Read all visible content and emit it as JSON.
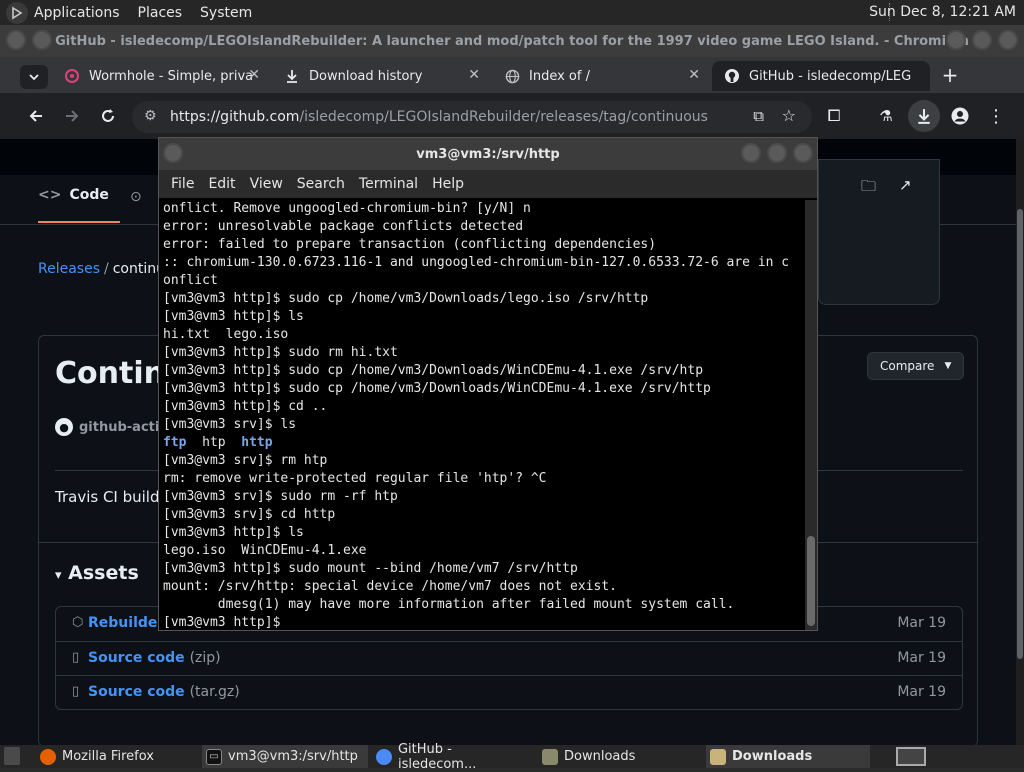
{
  "top_panel": {
    "menus": [
      "Applications",
      "Places",
      "System"
    ],
    "clock": "Sun Dec  8, 12:21 AM"
  },
  "chromium": {
    "window_title": "GitHub - isledecomp/LEGOIslandRebuilder: A launcher and mod/patch tool for the 1997 video game LEGO Island. - Chromium",
    "tabs": [
      {
        "title": "Wormhole - Simple, priva",
        "icon": "wormhole-icon"
      },
      {
        "title": "Download history",
        "icon": "download-icon"
      },
      {
        "title": "Index of /",
        "icon": "globe-icon"
      },
      {
        "title": "GitHub - isledecomp/LEG",
        "icon": "github-icon",
        "active": true
      }
    ],
    "url_host": "https://github.com",
    "url_path": "/isledecomp/LEGOIslandRebuilder/releases/tag/continuous"
  },
  "github": {
    "code_tab": "Code",
    "breadcrumb_link": "Releases",
    "breadcrumb_sep": "/",
    "breadcrumb_current": "continu",
    "release_title": "Contin",
    "compare_label": "Compare",
    "author": "github-actio",
    "body_text": "Travis CI build",
    "assets_heading": "Assets",
    "assets": [
      {
        "name": "Rebuilder.e",
        "format": "",
        "date": "Mar 19",
        "icon": "package-icon"
      },
      {
        "name": "Source code",
        "format": "(zip)",
        "date": "Mar 19",
        "icon": "file-zip-icon"
      },
      {
        "name": "Source code",
        "format": "(tar.gz)",
        "date": "Mar 19",
        "icon": "file-zip-icon"
      }
    ]
  },
  "terminal": {
    "title": "vm3@vm3:/srv/http",
    "menu": [
      "File",
      "Edit",
      "View",
      "Search",
      "Terminal",
      "Help"
    ],
    "lines": [
      "onflict. Remove ungoogled-chromium-bin? [y/N] n",
      "error: unresolvable package conflicts detected",
      "error: failed to prepare transaction (conflicting dependencies)",
      ":: chromium-130.0.6723.116-1 and ungoogled-chromium-bin-127.0.6533.72-6 are in c",
      "onflict",
      "[vm3@vm3 http]$ sudo cp /home/vm3/Downloads/lego.iso /srv/http",
      "[vm3@vm3 http]$ ls",
      "hi.txt  lego.iso",
      "[vm3@vm3 http]$ sudo rm hi.txt",
      "[vm3@vm3 http]$ sudo cp /home/vm3/Downloads/WinCDEmu-4.1.exe /srv/htp",
      "[vm3@vm3 http]$ sudo cp /home/vm3/Downloads/WinCDEmu-4.1.exe /srv/http",
      "[vm3@vm3 http]$ cd ..",
      "[vm3@vm3 srv]$ ls",
      "",
      "[vm3@vm3 srv]$ rm htp",
      "rm: remove write-protected regular file 'htp'? ^C",
      "[vm3@vm3 srv]$ sudo rm -rf htp",
      "[vm3@vm3 srv]$ cd http",
      "[vm3@vm3 http]$ ls",
      "lego.iso  WinCDEmu-4.1.exe",
      "[vm3@vm3 http]$ sudo mount --bind /home/vm7 /srv/http",
      "mount: /srv/http: special device /home/vm7 does not exist.",
      "       dmesg(1) may have more information after failed mount system call.",
      "[vm3@vm3 http]$ "
    ],
    "ls_output": {
      "a": "ftp",
      "b": "htp",
      "c": "http"
    }
  },
  "taskbar": {
    "items": [
      {
        "label": "Mozilla Firefox",
        "icon": "firefox-icon"
      },
      {
        "label": "vm3@vm3:/srv/http",
        "icon": "terminal-icon",
        "active": true
      },
      {
        "label": "GitHub - isledecom...",
        "icon": "chromium-icon"
      },
      {
        "label": "Downloads",
        "icon": "folder-icon"
      },
      {
        "label": "Downloads",
        "icon": "folder-icon",
        "active": true
      }
    ]
  }
}
